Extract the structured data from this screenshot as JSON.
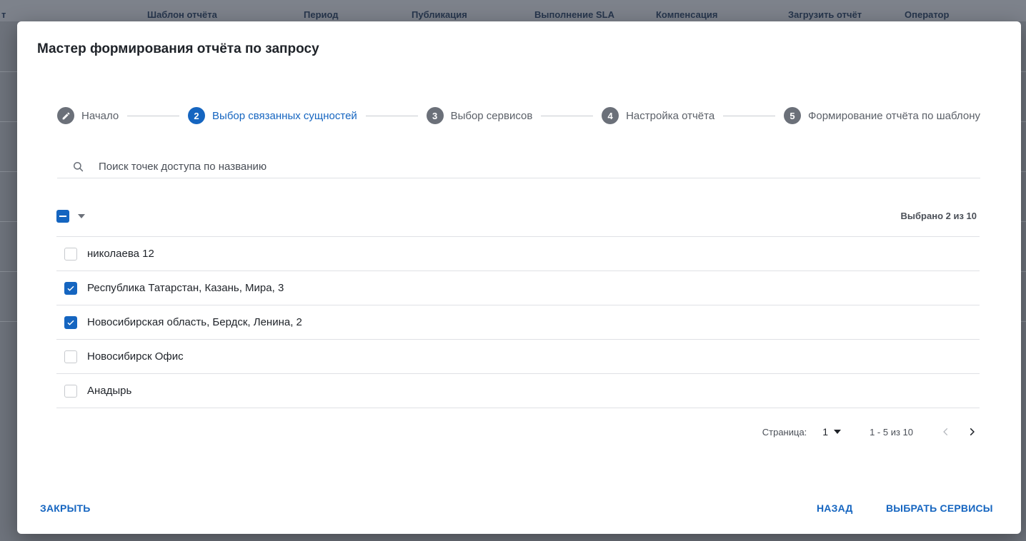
{
  "background": {
    "columns": [
      "т",
      "Шаблон отчёта",
      "Период",
      "Публикация",
      "Выполнение SLA",
      "Компенсация",
      "Загрузить отчёт",
      "Оператор"
    ]
  },
  "dialog": {
    "title": "Мастер формирования отчёта по запросу",
    "steps": [
      {
        "number": "",
        "label": "Начало",
        "state": "done",
        "icon": "pencil-icon"
      },
      {
        "number": "2",
        "label": "Выбор связанных сущностей",
        "state": "active"
      },
      {
        "number": "3",
        "label": "Выбор сервисов",
        "state": "pending"
      },
      {
        "number": "4",
        "label": "Настройка отчёта",
        "state": "pending"
      },
      {
        "number": "5",
        "label": "Формирование отчёта по шаблону",
        "state": "pending"
      }
    ],
    "search": {
      "placeholder": "Поиск точек доступа по названию",
      "value": ""
    },
    "selection": {
      "count_label": "Выбрано 2 из 10",
      "master_state": "indeterminate"
    },
    "items": [
      {
        "label": "николаева 12",
        "checked": false
      },
      {
        "label": "Республика Татарстан, Казань, Мира, 3",
        "checked": true
      },
      {
        "label": "Новосибирская область, Бердск, Ленина, 2",
        "checked": true
      },
      {
        "label": "Новосибирск Офис",
        "checked": false
      },
      {
        "label": "Анадырь",
        "checked": false
      }
    ],
    "pagination": {
      "page_label": "Страница:",
      "page_value": "1",
      "range": "1 - 5 из 10"
    },
    "buttons": {
      "close": "ЗАКРЫТЬ",
      "back": "НАЗАД",
      "next": "ВЫБРАТЬ СЕРВИСЫ"
    }
  },
  "colors": {
    "accent": "#1565c0",
    "overlay": "#6e737c",
    "step_pending": "#6b7079"
  }
}
